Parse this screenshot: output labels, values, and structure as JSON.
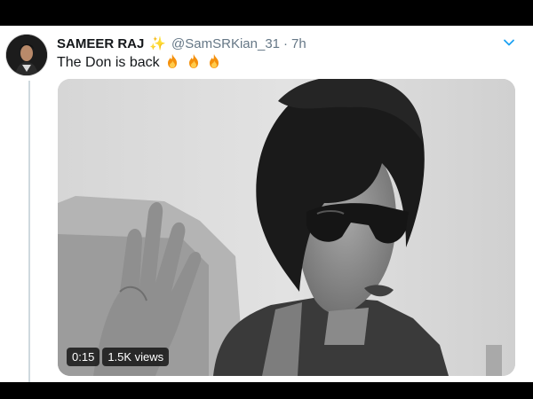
{
  "tweet": {
    "display_name": "SAMEER RAJ",
    "name_decoration_icon": "sparkles-icon",
    "handle": "@SamSRKian_31",
    "separator": "·",
    "time_ago": "7h",
    "text": "The Don is back",
    "text_emoji_icons": [
      "fire-icon",
      "fire-icon",
      "fire-icon"
    ],
    "menu_icon": "chevron-down-icon"
  },
  "video": {
    "duration": "0:15",
    "views": "1.5K views"
  },
  "colors": {
    "name_text": "#14171a",
    "secondary_text": "#657786",
    "caret": "#1da1f2",
    "frame_background": "#000000"
  }
}
